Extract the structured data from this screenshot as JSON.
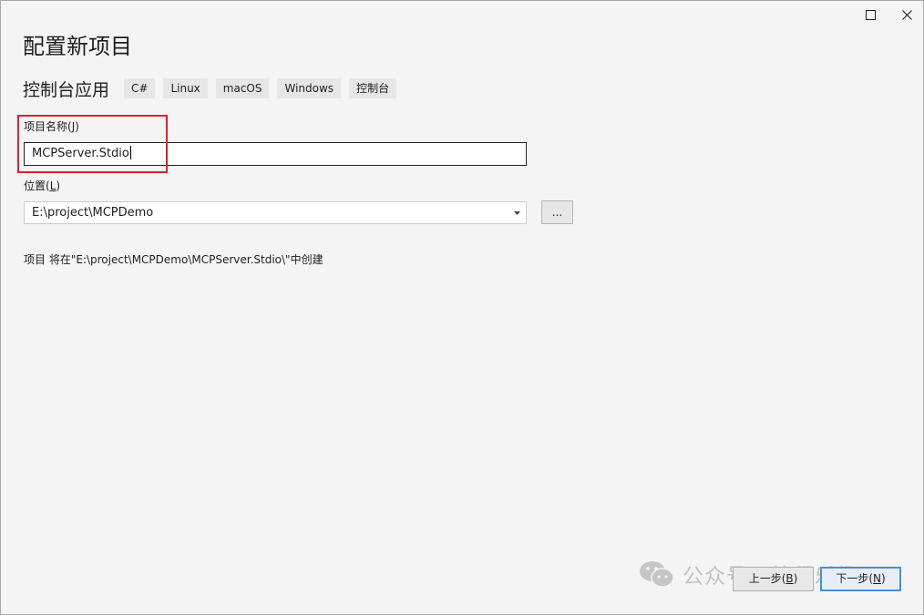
{
  "window": {
    "maximize_icon": "maximize-icon",
    "close_icon": "close-icon"
  },
  "header": {
    "title": "配置新项目",
    "template_name": "控制台应用",
    "tags": [
      "C#",
      "Linux",
      "macOS",
      "Windows",
      "控制台"
    ]
  },
  "project_name": {
    "label": "项目名称(",
    "access_key": "J",
    "label_end": ")",
    "value": "MCPServer.Stdio"
  },
  "location": {
    "label": "位置(",
    "access_key": "L",
    "label_end": ")",
    "value": "E:\\project\\MCPDemo",
    "browse_label": "..."
  },
  "path_info": "项目 将在\"E:\\project\\MCPDemo\\MCPServer.Stdio\\\"中创建",
  "footer": {
    "back_label": "上一步(",
    "back_key": "B",
    "back_end": ")",
    "next_label": "下一步(",
    "next_key": "N",
    "next_end": ")"
  },
  "watermark": {
    "text": "公众号 · 编程乐趣",
    "icon": "wechat-icon"
  },
  "colors": {
    "highlight": "#e0202c",
    "accent": "#4a8fd6"
  }
}
